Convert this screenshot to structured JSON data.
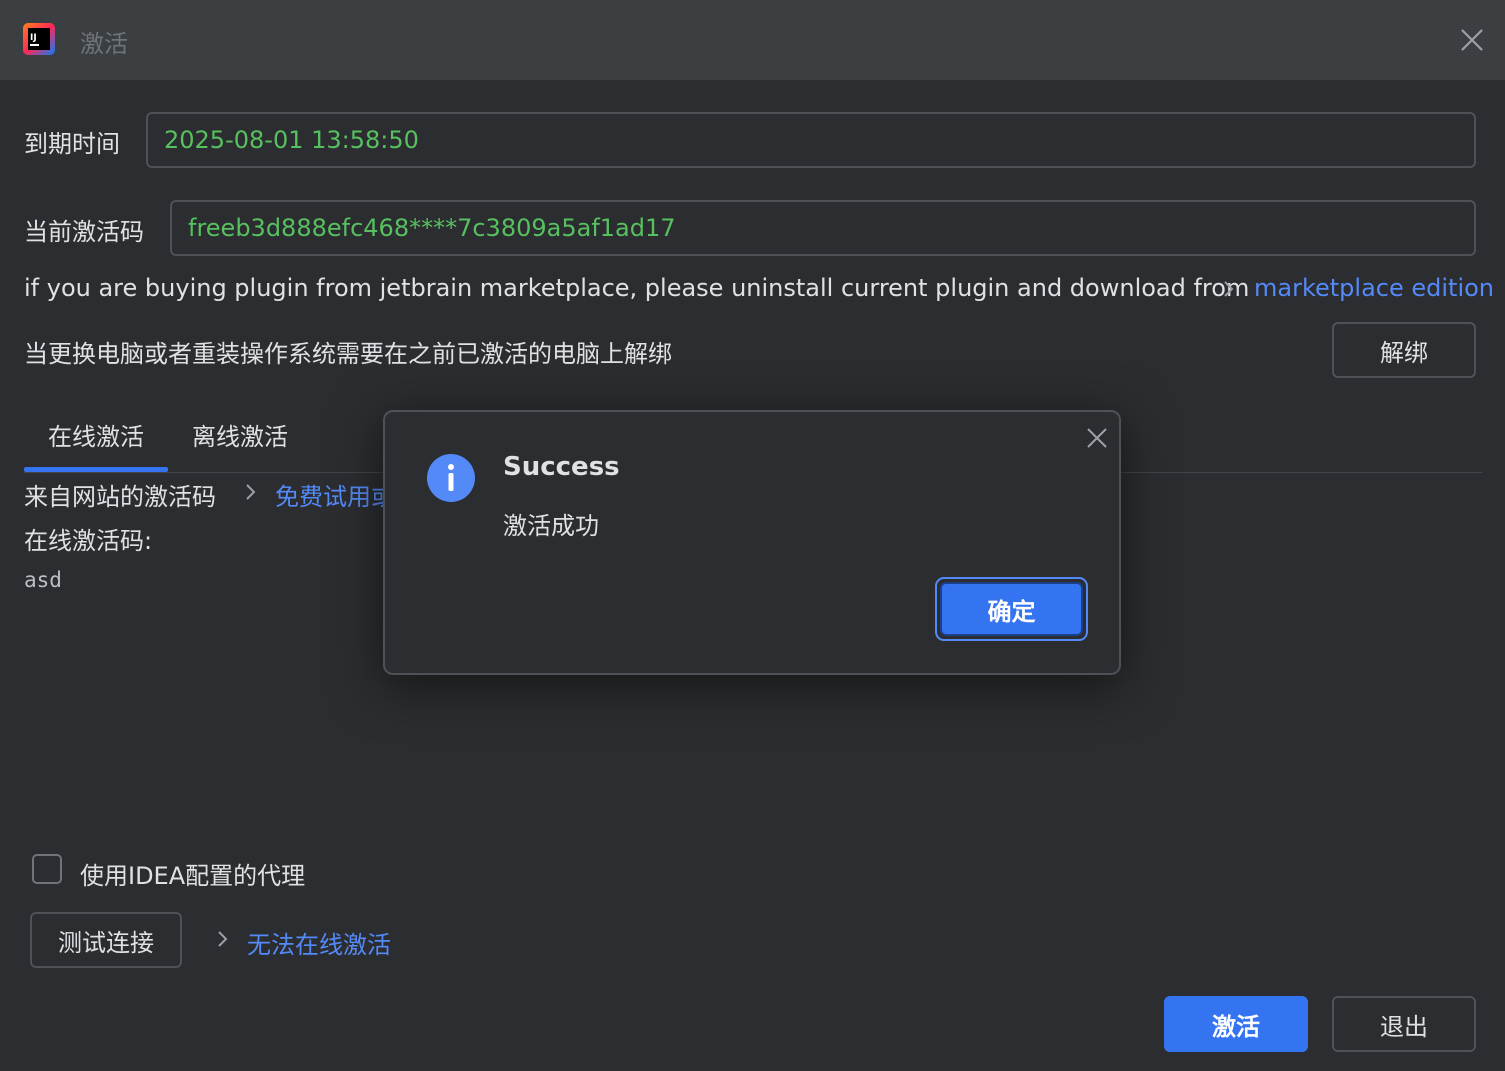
{
  "window": {
    "title": "激活",
    "app_icon": "intellij-idea-icon"
  },
  "expiry": {
    "label": "到期时间",
    "value": "2025-08-01 13:58:50"
  },
  "current_code": {
    "label": "当前激活码",
    "value": "freeb3d888efc468****7c3809a5af1ad17"
  },
  "marketplace": {
    "notice": "if you are buying plugin from jetbrain marketplace, please uninstall current plugin and download from",
    "link": "marketplace edition"
  },
  "unbind": {
    "notice": "当更换电脑或者重装操作系统需要在之前已激活的电脑上解绑",
    "button": "解绑"
  },
  "tabs": [
    {
      "label": "在线激活",
      "selected": true
    },
    {
      "label": "离线激活",
      "selected": false
    }
  ],
  "online": {
    "source_label": "来自网站的激活码",
    "source_link": "免费试用或",
    "code_label": "在线激活码:",
    "code_value": "asd"
  },
  "proxy": {
    "label": "使用IDEA配置的代理",
    "checked": false
  },
  "test_button": "测试连接",
  "cannot_activate_link": "无法在线激活",
  "footer": {
    "activate": "激活",
    "exit": "退出"
  },
  "dialog": {
    "icon": "info-icon",
    "title": "Success",
    "message": "激活成功",
    "ok": "确定"
  },
  "colors": {
    "accent": "#3574f0",
    "link": "#548af7",
    "value_green": "#57c05f",
    "background": "#2b2d30"
  }
}
